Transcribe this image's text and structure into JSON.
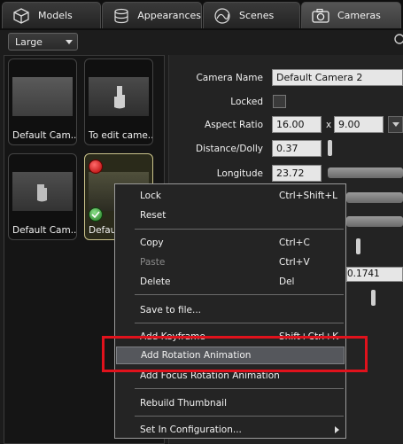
{
  "tabs": [
    {
      "label": "Models",
      "icon": "cube-icon"
    },
    {
      "label": "Appearances",
      "icon": "cylinder-icon"
    },
    {
      "label": "Scenes",
      "icon": "scene-icon"
    },
    {
      "label": "Cameras",
      "icon": "camera-icon",
      "active": true
    }
  ],
  "size_dropdown": {
    "value": "Large"
  },
  "thumbnails": [
    {
      "caption": "Default Cam..."
    },
    {
      "caption": "To edit came..."
    },
    {
      "caption": "Default Cam..."
    },
    {
      "caption": "Defau"
    }
  ],
  "properties": {
    "camera_name_label": "Camera Name",
    "camera_name_value": "Default Camera 2",
    "locked_label": "Locked",
    "aspect_ratio_label": "Aspect Ratio",
    "aspect_w": "16.00",
    "aspect_x": "x",
    "aspect_h": "9.00",
    "distance_label": "Distance/Dolly",
    "distance_value": "0.37",
    "longitude_label": "Longitude",
    "longitude_value": "23.72",
    "partial_value": "0.1741"
  },
  "context_menu": {
    "items": [
      {
        "label": "Lock",
        "shortcut": "Ctrl+Shift+L"
      },
      {
        "label": "Reset",
        "shortcut": ""
      },
      {
        "label": "Copy",
        "shortcut": "Ctrl+C"
      },
      {
        "label": "Paste",
        "shortcut": "Ctrl+V",
        "disabled": true
      },
      {
        "label": "Delete",
        "shortcut": "Del"
      },
      {
        "label": "Save to file...",
        "shortcut": ""
      },
      {
        "label": "Add Keyframe",
        "shortcut": "Shift+Ctrl+K"
      },
      {
        "label": "Add Rotation Animation",
        "shortcut": "",
        "highlighted": true
      },
      {
        "label": "Add Focus Rotation Animation",
        "shortcut": ""
      },
      {
        "label": "Rebuild Thumbnail",
        "shortcut": ""
      },
      {
        "label": "Set In Configuration...",
        "shortcut": ""
      }
    ]
  },
  "colors": {
    "highlight_box": "#e0121c",
    "status_red": "#d01010",
    "status_green": "#2a9a2a"
  }
}
